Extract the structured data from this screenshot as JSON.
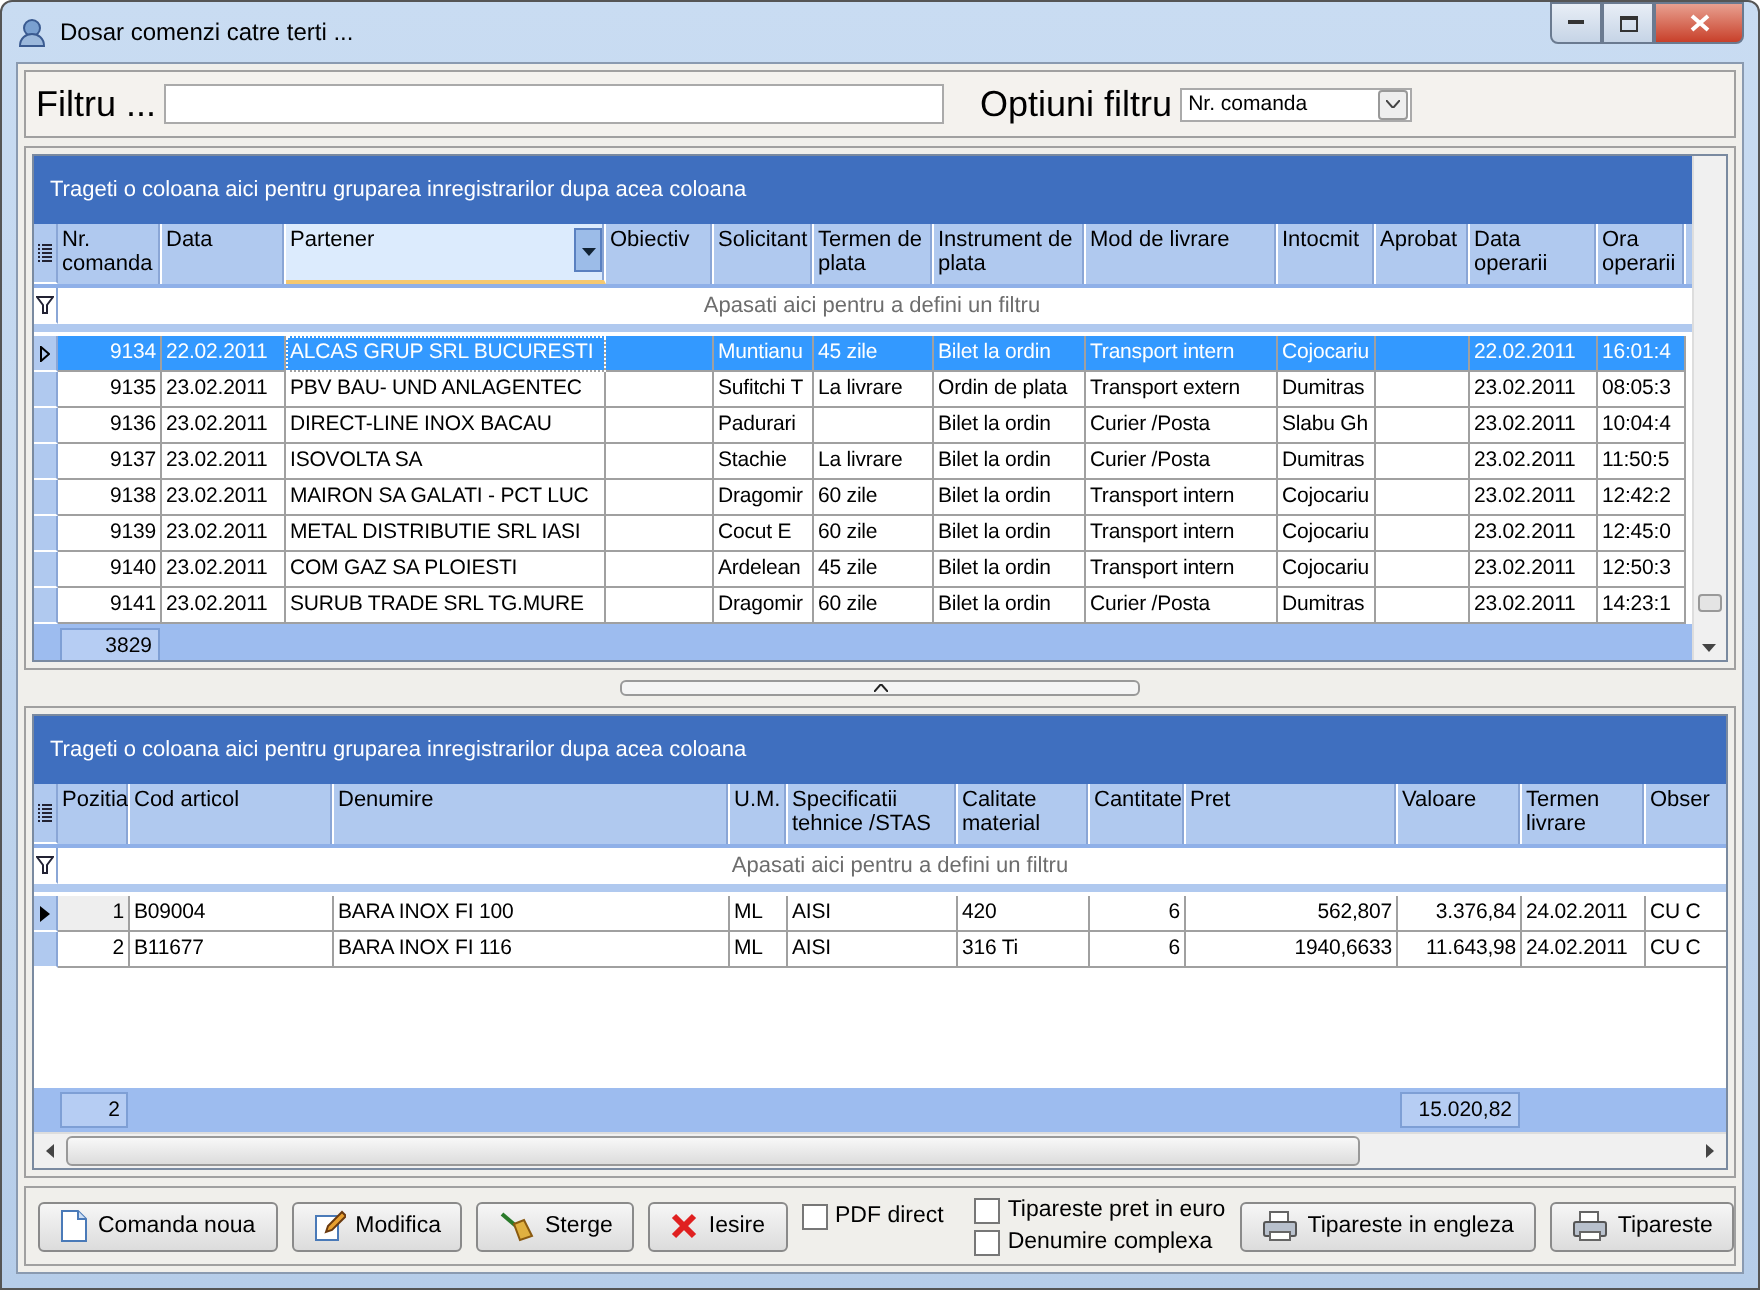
{
  "window": {
    "title": "Dosar comenzi catre terti ..."
  },
  "filter": {
    "label": "Filtru ...",
    "options_label": "Optiuni filtru",
    "option": "Nr. comanda"
  },
  "orders_grid": {
    "group_hint": "Trageti o coloana aici pentru gruparea inregistrarilor dupa acea coloana",
    "filter_hint": "Apasati aici pentru a defini un filtru",
    "columns": [
      {
        "label": "Nr. comanda",
        "kind": "number",
        "selected": false
      },
      {
        "label": "Data",
        "kind": "text",
        "selected": false
      },
      {
        "label": "Partener",
        "kind": "text",
        "selected": true
      },
      {
        "label": "Obiectiv",
        "kind": "text",
        "selected": false
      },
      {
        "label": "Solicitant",
        "kind": "text",
        "selected": false
      },
      {
        "label": "Termen de plata",
        "kind": "text",
        "selected": false
      },
      {
        "label": "Instrument de plata",
        "kind": "text",
        "selected": false
      },
      {
        "label": "Mod de livrare",
        "kind": "text",
        "selected": false
      },
      {
        "label": "Intocmit",
        "kind": "text",
        "selected": false
      },
      {
        "label": "Aprobat",
        "kind": "text",
        "selected": false
      },
      {
        "label": "Data operarii",
        "kind": "text",
        "selected": false
      },
      {
        "label": "Ora operarii",
        "kind": "text",
        "selected": false
      }
    ],
    "rows": [
      {
        "selected": true,
        "cells": [
          "9134",
          "22.02.2011",
          "ALCAS GRUP SRL BUCURESTI",
          "",
          "Muntianu",
          "45 zile",
          "Bilet la ordin",
          "Transport intern",
          "Cojocariu",
          "",
          "22.02.2011",
          "16:01:4"
        ]
      },
      {
        "selected": false,
        "cells": [
          "9135",
          "23.02.2011",
          "PBV BAU- UND ANLAGENTEC",
          "",
          "Sufitchi T",
          "La livrare",
          "Ordin de plata",
          "Transport extern",
          "Dumitras",
          "",
          "23.02.2011",
          "08:05:3"
        ]
      },
      {
        "selected": false,
        "cells": [
          "9136",
          "23.02.2011",
          "DIRECT-LINE INOX BACAU",
          "",
          "Padurari",
          "",
          "Bilet la ordin",
          "Curier /Posta",
          "Slabu Gh",
          "",
          "23.02.2011",
          "10:04:4"
        ]
      },
      {
        "selected": false,
        "cells": [
          "9137",
          "23.02.2011",
          "ISOVOLTA SA",
          "",
          "Stachie",
          "La livrare",
          "Bilet la ordin",
          "Curier /Posta",
          "Dumitras",
          "",
          "23.02.2011",
          "11:50:5"
        ]
      },
      {
        "selected": false,
        "cells": [
          "9138",
          "23.02.2011",
          "MAIRON SA GALATI - PCT LUC",
          "",
          "Dragomir",
          "60 zile",
          "Bilet la ordin",
          "Transport intern",
          "Cojocariu",
          "",
          "23.02.2011",
          "12:42:2"
        ]
      },
      {
        "selected": false,
        "cells": [
          "9139",
          "23.02.2011",
          "METAL DISTRIBUTIE SRL IASI",
          "",
          "Cocut E",
          "60 zile",
          "Bilet la ordin",
          "Transport intern",
          "Cojocariu",
          "",
          "23.02.2011",
          "12:45:0"
        ]
      },
      {
        "selected": false,
        "cells": [
          "9140",
          "23.02.2011",
          "COM GAZ SA PLOIESTI",
          "",
          "Ardelean",
          "45 zile",
          "Bilet la ordin",
          "Transport intern",
          "Cojocariu",
          "",
          "23.02.2011",
          "12:50:3"
        ]
      },
      {
        "selected": false,
        "cells": [
          "9141",
          "23.02.2011",
          "SURUB TRADE SRL TG.MURE",
          "",
          "Dragomir",
          "60 zile",
          "Bilet la ordin",
          "Curier /Posta",
          "Dumitras",
          "",
          "23.02.2011",
          "14:23:1"
        ]
      }
    ],
    "footer": {
      "count": "3829"
    }
  },
  "items_grid": {
    "group_hint": "Trageti o coloana aici pentru gruparea inregistrarilor dupa acea coloana",
    "filter_hint": "Apasati aici pentru a defini un filtru",
    "columns": [
      {
        "label": "Pozitia",
        "kind": "number",
        "selected": false
      },
      {
        "label": "Cod articol",
        "kind": "text",
        "selected": false
      },
      {
        "label": "Denumire",
        "kind": "text",
        "selected": false
      },
      {
        "label": "U.M.",
        "kind": "text",
        "selected": false
      },
      {
        "label": "Specificatii tehnice /STAS",
        "kind": "text",
        "selected": false
      },
      {
        "label": "Calitate material",
        "kind": "text",
        "selected": false
      },
      {
        "label": "Cantitate",
        "kind": "number",
        "selected": false
      },
      {
        "label": "Pret",
        "kind": "number",
        "selected": false
      },
      {
        "label": "Valoare",
        "kind": "sum",
        "selected": false
      },
      {
        "label": "Termen livrare",
        "kind": "text",
        "selected": false
      },
      {
        "label": "Obser",
        "kind": "text",
        "selected": false
      }
    ],
    "rows": [
      {
        "selected": true,
        "cells": [
          "1",
          "B09004",
          "BARA INOX FI 100",
          "ML",
          "AISI",
          "420",
          "6",
          "562,807",
          "3.376,84",
          "24.02.2011",
          "CU C"
        ]
      },
      {
        "selected": false,
        "cells": [
          "2",
          "B11677",
          "BARA INOX FI 116",
          "ML",
          "AISI",
          "316 Ti",
          "6",
          "1940,6633",
          "11.643,98",
          "24.02.2011",
          "CU C"
        ]
      }
    ],
    "footer": {
      "count": "2",
      "total": "15.020,82"
    }
  },
  "buttons": [
    {
      "label": "Comanda noua",
      "kind": "new"
    },
    {
      "label": "Modifica",
      "kind": "edit"
    },
    {
      "label": "Sterge",
      "kind": "delete"
    },
    {
      "label": "Iesire",
      "kind": "exit"
    }
  ],
  "options": [
    {
      "label": "PDF direct",
      "checked": false
    },
    {
      "label": "Tipareste pret in euro",
      "checked": false
    },
    {
      "label": "Denumire complexa",
      "checked": false
    }
  ],
  "print_buttons": [
    {
      "label": "Tipareste in engleza",
      "kind": "print"
    },
    {
      "label": "Tipareste",
      "kind": "print"
    }
  ]
}
